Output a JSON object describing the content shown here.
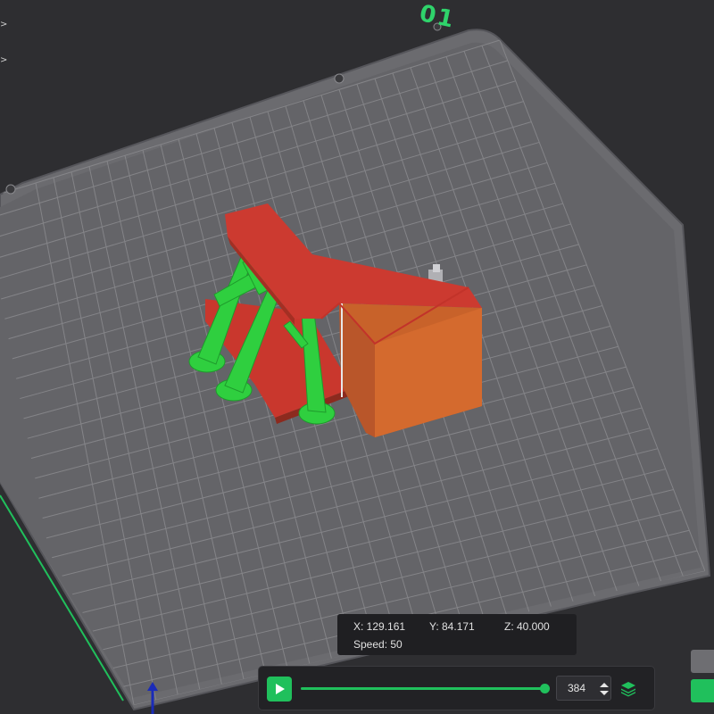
{
  "plate": {
    "label": "01"
  },
  "side_toolbar": {
    "expand_glyph_1": ">",
    "expand_glyph_2": ">"
  },
  "coordinates": {
    "x": "X: 129.161",
    "y": "Y: 84.171",
    "z": "Z: 40.000",
    "speed": "Speed: 50"
  },
  "playback": {
    "layer_value": "384",
    "progress": 0.99
  },
  "icons": {
    "play": "play-icon",
    "stepper": "spin-arrows-icon",
    "layers": "layers-icon"
  },
  "colors": {
    "accent": "#20c05c",
    "model_top": "#c73a2f",
    "model_side": "#c45a24",
    "support": "#2fcf3f",
    "bed_grid": "#7a7a7e"
  }
}
